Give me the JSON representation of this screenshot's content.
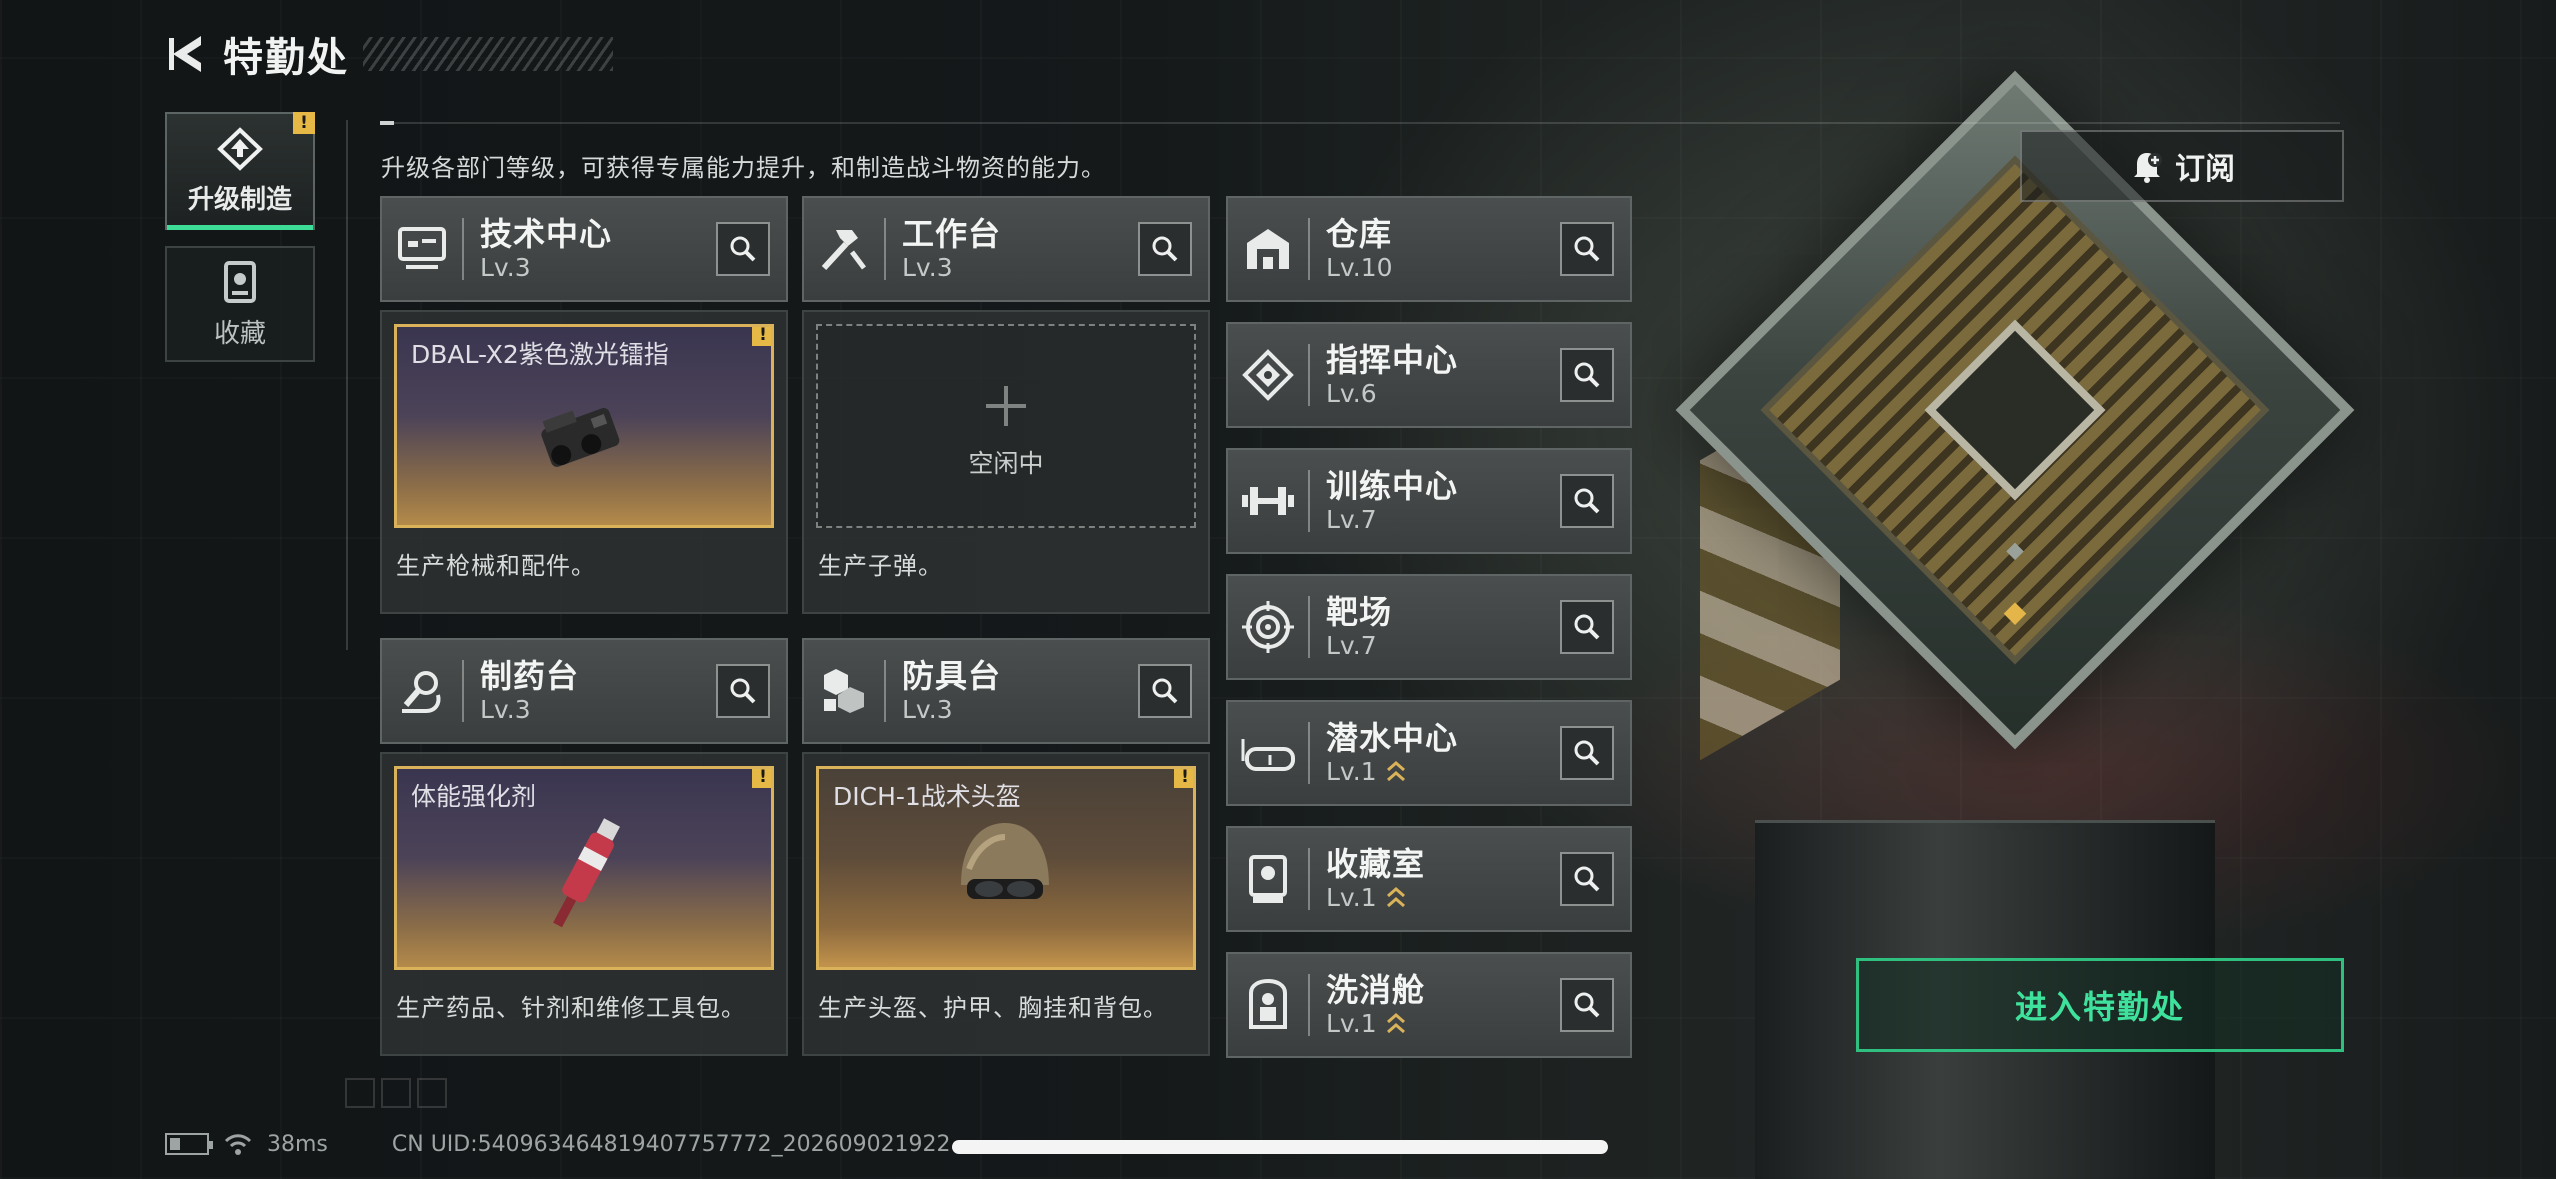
{
  "header": {
    "title": "特勤处"
  },
  "side_tabs": [
    {
      "label": "升级制造",
      "active": true,
      "alert": "!"
    },
    {
      "label": "收藏",
      "active": false
    }
  ],
  "subtitle": "升级各部门等级，可获得专属能力提升，和制造战斗物资的能力。",
  "subscribe": {
    "label": "订阅"
  },
  "enter": {
    "label": "进入特勤处"
  },
  "production": [
    {
      "name": "技术中心",
      "level": "Lv.3",
      "icon": "tech-center-icon",
      "slot": {
        "state": "active",
        "item": "DBAL-X2紫色激光镭指",
        "alert": "!",
        "tone": "purple"
      },
      "desc": "生产枪械和配件。"
    },
    {
      "name": "工作台",
      "level": "Lv.3",
      "icon": "workbench-icon",
      "slot": {
        "state": "idle",
        "idle_label": "空闲中"
      },
      "desc": "生产子弹。"
    },
    {
      "name": "制药台",
      "level": "Lv.3",
      "icon": "pharmacy-icon",
      "slot": {
        "state": "active",
        "item": "体能强化剂",
        "alert": "!",
        "tone": "purple"
      },
      "desc": "生产药品、针剂和维修工具包。"
    },
    {
      "name": "防具台",
      "level": "Lv.3",
      "icon": "armor-bench-icon",
      "slot": {
        "state": "active",
        "item": "DICH-1战术头盔",
        "alert": "!",
        "tone": "brown"
      },
      "desc": "生产头盔、护甲、胸挂和背包。"
    }
  ],
  "facilities": [
    {
      "name": "仓库",
      "level": "Lv.10",
      "icon": "warehouse-icon",
      "upgradable": false
    },
    {
      "name": "指挥中心",
      "level": "Lv.6",
      "icon": "command-center-icon",
      "upgradable": false
    },
    {
      "name": "训练中心",
      "level": "Lv.7",
      "icon": "dumbbell-icon",
      "upgradable": false
    },
    {
      "name": "靶场",
      "level": "Lv.7",
      "icon": "target-icon",
      "upgradable": false
    },
    {
      "name": "潜水中心",
      "level": "Lv.1",
      "icon": "diving-mask-icon",
      "upgradable": true
    },
    {
      "name": "收藏室",
      "level": "Lv.1",
      "icon": "collection-room-icon",
      "upgradable": true
    },
    {
      "name": "洗消舱",
      "level": "Lv.1",
      "icon": "decontamination-icon",
      "upgradable": true
    }
  ],
  "footer": {
    "ping": "38ms",
    "uid": "CN UID:540963464819407757772_202609021922"
  },
  "colors": {
    "accent_green": "#3fe29c",
    "alert_yellow": "#e6b845",
    "slot_gold": "#d9b25a"
  }
}
